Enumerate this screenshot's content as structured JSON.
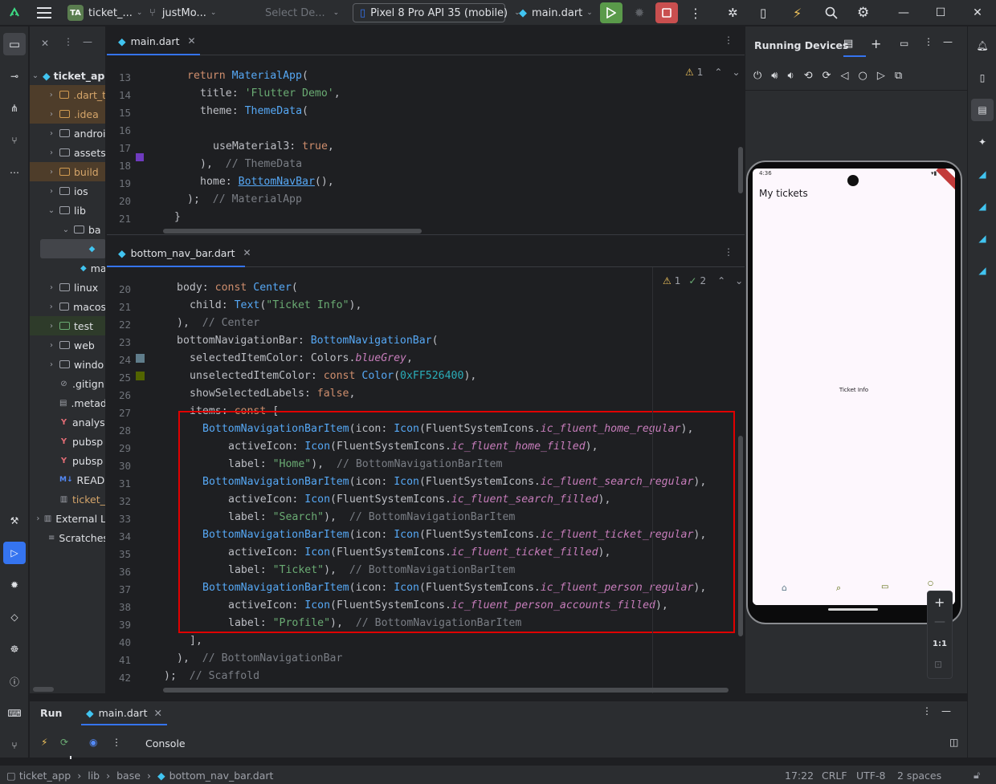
{
  "topbar": {
    "project_badge": "TA",
    "project_name": "ticket_...",
    "branch_name": "justMo...",
    "device_selector_placeholder": "Select De...",
    "run_device": "Pixel 8 Pro API 35 (mobile)",
    "run_config": "main.dart"
  },
  "project_tree": {
    "root": "ticket_ap",
    "items": [
      {
        "label": ".dart_t"
      },
      {
        "label": ".idea"
      },
      {
        "label": "androi"
      },
      {
        "label": "assets"
      },
      {
        "label": "build"
      },
      {
        "label": "ios"
      },
      {
        "label": "lib"
      },
      {
        "label": "ba"
      },
      {
        "label": ""
      },
      {
        "label": "ma"
      },
      {
        "label": "linux"
      },
      {
        "label": "macos"
      },
      {
        "label": "test"
      },
      {
        "label": "web"
      },
      {
        "label": "windo"
      },
      {
        "label": ".gitign"
      },
      {
        "label": ".metad"
      },
      {
        "label": "analys"
      },
      {
        "label": "pubsp"
      },
      {
        "label": "pubsp"
      },
      {
        "label": "READI"
      },
      {
        "label": "ticket_"
      },
      {
        "label": "External L"
      },
      {
        "label": "Scratches"
      }
    ]
  },
  "editor_top": {
    "tab_label": "main.dart",
    "warnings": "1",
    "line_numbers": [
      "13",
      "14",
      "15",
      "16",
      "17",
      "18",
      "19",
      "20",
      "21"
    ],
    "lines": {
      "l13": {
        "kw": "return",
        "cls": "MaterialApp",
        "rest": "("
      },
      "l14": {
        "prop": "title: ",
        "str": "'Flutter Demo'",
        "rest": ","
      },
      "l15": {
        "prop": "theme: ",
        "cls": "ThemeData",
        "rest": "("
      },
      "l17": {
        "prop": "useMaterial3: ",
        "kw": "true",
        "rest": ","
      },
      "l18": {
        "rest": "),  ",
        "cmt": "// ThemeData"
      },
      "l19": {
        "prop": "home: ",
        "cls": "BottomNavBar",
        "rest": "(),"
      },
      "l20": {
        "rest": ");  ",
        "cmt": "// MaterialApp"
      },
      "l21": {
        "rest": "}"
      }
    }
  },
  "editor_bottom": {
    "tab_label": "bottom_nav_bar.dart",
    "warnings": "1",
    "checks": "2",
    "line_numbers": [
      "20",
      "21",
      "22",
      "23",
      "24",
      "25",
      "26",
      "27",
      "28",
      "29",
      "30",
      "31",
      "32",
      "33",
      "34",
      "35",
      "36",
      "37",
      "38",
      "39",
      "40",
      "41",
      "42"
    ],
    "code": {
      "body_kw": "body: ",
      "const_kw": "const ",
      "center": "Center",
      "paren": "(",
      "child": "child: ",
      "text_cls": "Text",
      "ticket_info": "\"Ticket Info\"",
      "close_paren_comma": "),",
      "center_close": "),  ",
      "center_cmt": "// Center",
      "bnb_prop": "bottomNavigationBar: ",
      "bnb_cls": "BottomNavigationBar",
      "sel_prop": "selectedItemColor: ",
      "sel_val_pre": "Colors.",
      "sel_val": "blueGrey",
      "comma": ",",
      "unsel_prop": "unselectedItemColor: ",
      "color_cls": "Color",
      "color_num": "0xFF526400",
      "color_tail": "),",
      "show_prop": "showSelectedLabels: ",
      "false_kw": "false",
      "items_prop": "items: ",
      "bracket": "[",
      "item_cls": "BottomNavigationBarItem",
      "icon_prop": "(icon: ",
      "icon_cls": "Icon",
      "fsi": "(FluentSystemIcons.",
      "active_prop": "activeIcon: ",
      "label_prop": "label: ",
      "item_cmt": "// BottomNavigationBarItem",
      "items": [
        {
          "regular": "ic_fluent_home_regular",
          "filled": "ic_fluent_home_filled",
          "label": "\"Home\""
        },
        {
          "regular": "ic_fluent_search_regular",
          "filled": "ic_fluent_search_filled",
          "label": "\"Search\""
        },
        {
          "regular": "ic_fluent_ticket_regular",
          "filled": "ic_fluent_ticket_filled",
          "label": "\"Ticket\""
        },
        {
          "regular": "ic_fluent_person_regular",
          "filled": "ic_fluent_person_accounts_filled",
          "label": "\"Profile\""
        }
      ],
      "list_close": "],",
      "bnb_close": "),  ",
      "bnb_cmt": "// BottomNavigationBar",
      "scaffold_close": ");  ",
      "scaffold_cmt": "// Scaffold"
    }
  },
  "devices": {
    "title": "Running Devices",
    "app_title": "My tickets",
    "center_text": "Ticket Info",
    "zoom_label": "1:1",
    "status_time": "4:36"
  },
  "bottom_panel": {
    "run_label": "Run",
    "tab_label": "main.dart",
    "console_label": "Console"
  },
  "statusbar": {
    "crumbs": [
      "ticket_app",
      "lib",
      "base",
      "bottom_nav_bar.dart"
    ],
    "position": "17:22",
    "line_sep": "CRLF",
    "encoding": "UTF-8",
    "indent": "2 spaces"
  },
  "colors": {
    "highlight_box": "#e00000",
    "swatch_purple": "#6f3bbf",
    "swatch_bluegrey": "#607d8b",
    "swatch_olive": "#526400",
    "run_green": "#5a9a4a",
    "stop_red": "#c94f4f"
  }
}
